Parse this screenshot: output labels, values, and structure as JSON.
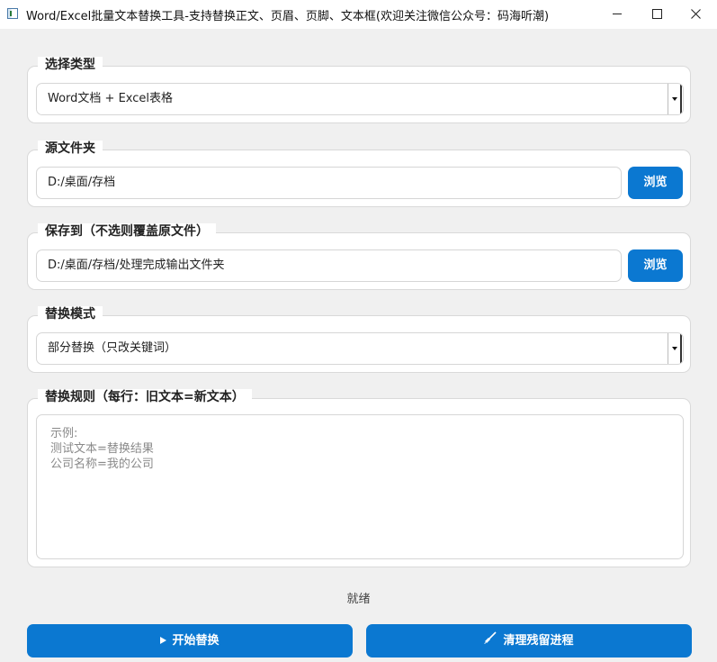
{
  "window": {
    "title": "Word/Excel批量文本替换工具-支持替换正文、页眉、页脚、文本框(欢迎关注微信公众号：码海听潮)"
  },
  "type_group": {
    "title": "选择类型",
    "selected": "Word文档 + Excel表格"
  },
  "source_group": {
    "title": "源文件夹",
    "path": "D:/桌面/存档",
    "browse_label": "浏览"
  },
  "save_group": {
    "title": "保存到（不选则覆盖原文件）",
    "path": "D:/桌面/存档/处理完成输出文件夹",
    "browse_label": "浏览"
  },
  "mode_group": {
    "title": "替换模式",
    "selected": "部分替换（只改关键词）"
  },
  "rules_group": {
    "title": "替换规则（每行：旧文本=新文本）",
    "placeholder": "示例:\n测试文本=替换结果\n公司名称=我的公司"
  },
  "status_text": "就绪",
  "actions": {
    "start_label": "开始替换",
    "clean_label": "清理残留进程"
  },
  "colors": {
    "accent": "#0b78d1",
    "background": "#f0f0f0",
    "panel": "#ffffff"
  },
  "icons": [
    "app-icon",
    "minimize-icon",
    "maximize-icon",
    "close-icon",
    "play-icon",
    "broom-icon",
    "chevron-down-icon"
  ]
}
